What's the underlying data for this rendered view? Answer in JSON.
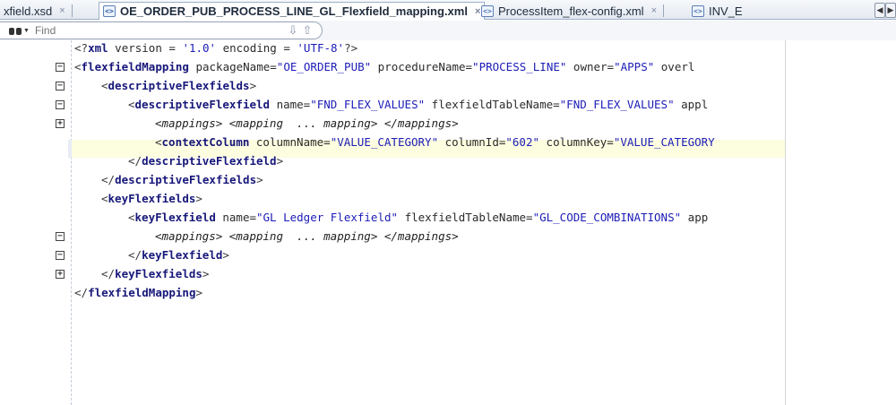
{
  "tabs": [
    {
      "label": "xfield.xsd",
      "close": "×"
    },
    {
      "label": "OE_ORDER_PUB_PROCESS_LINE_GL_Flexfield_mapping.xml",
      "close": "×"
    },
    {
      "label": "ProcessItem_flex-config.xml",
      "close": "×"
    },
    {
      "label": "INV_E",
      "close": ""
    }
  ],
  "tab_nav": {
    "left": "◀",
    "right": "▶"
  },
  "find": {
    "placeholder": "Find",
    "next": "⇩",
    "prev": "⇧"
  },
  "editor": {
    "lines": [
      {
        "parts": [
          "<?",
          "xml",
          " version = ",
          "'1.0'",
          " encoding = ",
          "'UTF-8'",
          "?>"
        ]
      },
      {
        "parts": [
          "<",
          "flexfieldMapping",
          " packageName=",
          "\"OE_ORDER_PUB\"",
          " procedureName=",
          "\"PROCESS_LINE\"",
          " owner=",
          "\"APPS\"",
          " overl"
        ]
      },
      {
        "parts": [
          "<",
          "descriptiveFlexfields",
          ">"
        ]
      },
      {
        "parts": [
          "<",
          "descriptiveFlexfield",
          " name=",
          "\"FND_FLEX_VALUES\"",
          " flexfieldTableName=",
          "\"FND_FLEX_VALUES\"",
          " appl"
        ]
      },
      {
        "parts": [
          "<mappings> <mapping  ... mapping> </mappings>"
        ]
      },
      {
        "parts": [
          "<",
          "contextColumn",
          " columnName=",
          "\"VALUE_CATEGORY\"",
          " columnId=",
          "\"602\"",
          " columnKey=",
          "\"VALUE_CATEGORY"
        ]
      },
      {
        "parts": [
          "</",
          "descriptiveFlexfield",
          ">"
        ]
      },
      {
        "parts": [
          "</",
          "descriptiveFlexfields",
          ">"
        ]
      },
      {
        "parts": [
          "<",
          "keyFlexfields",
          ">"
        ]
      },
      {
        "parts": [
          "<",
          "keyFlexfield",
          " name=",
          "\"GL Ledger Flexfield\"",
          " flexfieldTableName=",
          "\"GL_CODE_COMBINATIONS\"",
          " app"
        ]
      },
      {
        "parts": [
          "<mappings> <mapping  ... mapping> </mappings>"
        ]
      },
      {
        "parts": [
          "</",
          "keyFlexfield",
          ">"
        ]
      },
      {
        "parts": [
          "</",
          "keyFlexfields",
          ">"
        ]
      },
      {
        "parts": [
          "</",
          "flexfieldMapping",
          ">"
        ]
      }
    ],
    "fold_minus": "−",
    "fold_plus": "+"
  }
}
